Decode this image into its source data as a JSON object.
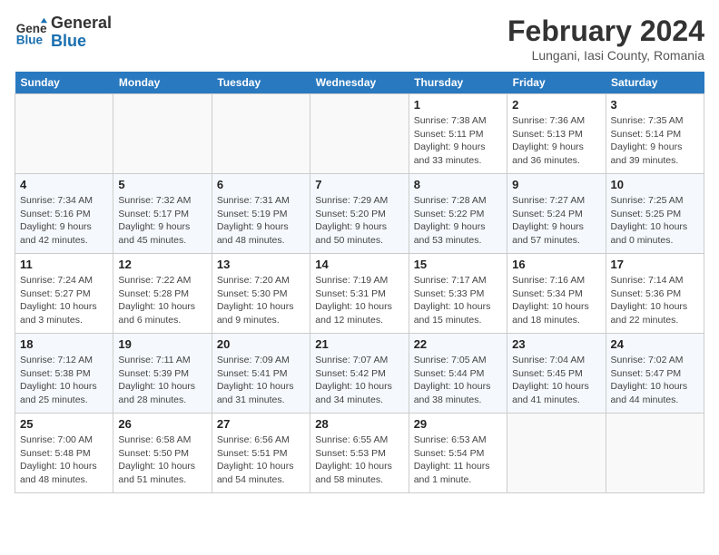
{
  "header": {
    "logo_line1": "General",
    "logo_line2": "Blue",
    "month": "February 2024",
    "location": "Lungani, Iasi County, Romania"
  },
  "weekdays": [
    "Sunday",
    "Monday",
    "Tuesday",
    "Wednesday",
    "Thursday",
    "Friday",
    "Saturday"
  ],
  "weeks": [
    [
      {
        "day": "",
        "info": ""
      },
      {
        "day": "",
        "info": ""
      },
      {
        "day": "",
        "info": ""
      },
      {
        "day": "",
        "info": ""
      },
      {
        "day": "1",
        "info": "Sunrise: 7:38 AM\nSunset: 5:11 PM\nDaylight: 9 hours\nand 33 minutes."
      },
      {
        "day": "2",
        "info": "Sunrise: 7:36 AM\nSunset: 5:13 PM\nDaylight: 9 hours\nand 36 minutes."
      },
      {
        "day": "3",
        "info": "Sunrise: 7:35 AM\nSunset: 5:14 PM\nDaylight: 9 hours\nand 39 minutes."
      }
    ],
    [
      {
        "day": "4",
        "info": "Sunrise: 7:34 AM\nSunset: 5:16 PM\nDaylight: 9 hours\nand 42 minutes."
      },
      {
        "day": "5",
        "info": "Sunrise: 7:32 AM\nSunset: 5:17 PM\nDaylight: 9 hours\nand 45 minutes."
      },
      {
        "day": "6",
        "info": "Sunrise: 7:31 AM\nSunset: 5:19 PM\nDaylight: 9 hours\nand 48 minutes."
      },
      {
        "day": "7",
        "info": "Sunrise: 7:29 AM\nSunset: 5:20 PM\nDaylight: 9 hours\nand 50 minutes."
      },
      {
        "day": "8",
        "info": "Sunrise: 7:28 AM\nSunset: 5:22 PM\nDaylight: 9 hours\nand 53 minutes."
      },
      {
        "day": "9",
        "info": "Sunrise: 7:27 AM\nSunset: 5:24 PM\nDaylight: 9 hours\nand 57 minutes."
      },
      {
        "day": "10",
        "info": "Sunrise: 7:25 AM\nSunset: 5:25 PM\nDaylight: 10 hours\nand 0 minutes."
      }
    ],
    [
      {
        "day": "11",
        "info": "Sunrise: 7:24 AM\nSunset: 5:27 PM\nDaylight: 10 hours\nand 3 minutes."
      },
      {
        "day": "12",
        "info": "Sunrise: 7:22 AM\nSunset: 5:28 PM\nDaylight: 10 hours\nand 6 minutes."
      },
      {
        "day": "13",
        "info": "Sunrise: 7:20 AM\nSunset: 5:30 PM\nDaylight: 10 hours\nand 9 minutes."
      },
      {
        "day": "14",
        "info": "Sunrise: 7:19 AM\nSunset: 5:31 PM\nDaylight: 10 hours\nand 12 minutes."
      },
      {
        "day": "15",
        "info": "Sunrise: 7:17 AM\nSunset: 5:33 PM\nDaylight: 10 hours\nand 15 minutes."
      },
      {
        "day": "16",
        "info": "Sunrise: 7:16 AM\nSunset: 5:34 PM\nDaylight: 10 hours\nand 18 minutes."
      },
      {
        "day": "17",
        "info": "Sunrise: 7:14 AM\nSunset: 5:36 PM\nDaylight: 10 hours\nand 22 minutes."
      }
    ],
    [
      {
        "day": "18",
        "info": "Sunrise: 7:12 AM\nSunset: 5:38 PM\nDaylight: 10 hours\nand 25 minutes."
      },
      {
        "day": "19",
        "info": "Sunrise: 7:11 AM\nSunset: 5:39 PM\nDaylight: 10 hours\nand 28 minutes."
      },
      {
        "day": "20",
        "info": "Sunrise: 7:09 AM\nSunset: 5:41 PM\nDaylight: 10 hours\nand 31 minutes."
      },
      {
        "day": "21",
        "info": "Sunrise: 7:07 AM\nSunset: 5:42 PM\nDaylight: 10 hours\nand 34 minutes."
      },
      {
        "day": "22",
        "info": "Sunrise: 7:05 AM\nSunset: 5:44 PM\nDaylight: 10 hours\nand 38 minutes."
      },
      {
        "day": "23",
        "info": "Sunrise: 7:04 AM\nSunset: 5:45 PM\nDaylight: 10 hours\nand 41 minutes."
      },
      {
        "day": "24",
        "info": "Sunrise: 7:02 AM\nSunset: 5:47 PM\nDaylight: 10 hours\nand 44 minutes."
      }
    ],
    [
      {
        "day": "25",
        "info": "Sunrise: 7:00 AM\nSunset: 5:48 PM\nDaylight: 10 hours\nand 48 minutes."
      },
      {
        "day": "26",
        "info": "Sunrise: 6:58 AM\nSunset: 5:50 PM\nDaylight: 10 hours\nand 51 minutes."
      },
      {
        "day": "27",
        "info": "Sunrise: 6:56 AM\nSunset: 5:51 PM\nDaylight: 10 hours\nand 54 minutes."
      },
      {
        "day": "28",
        "info": "Sunrise: 6:55 AM\nSunset: 5:53 PM\nDaylight: 10 hours\nand 58 minutes."
      },
      {
        "day": "29",
        "info": "Sunrise: 6:53 AM\nSunset: 5:54 PM\nDaylight: 11 hours\nand 1 minute."
      },
      {
        "day": "",
        "info": ""
      },
      {
        "day": "",
        "info": ""
      }
    ]
  ]
}
